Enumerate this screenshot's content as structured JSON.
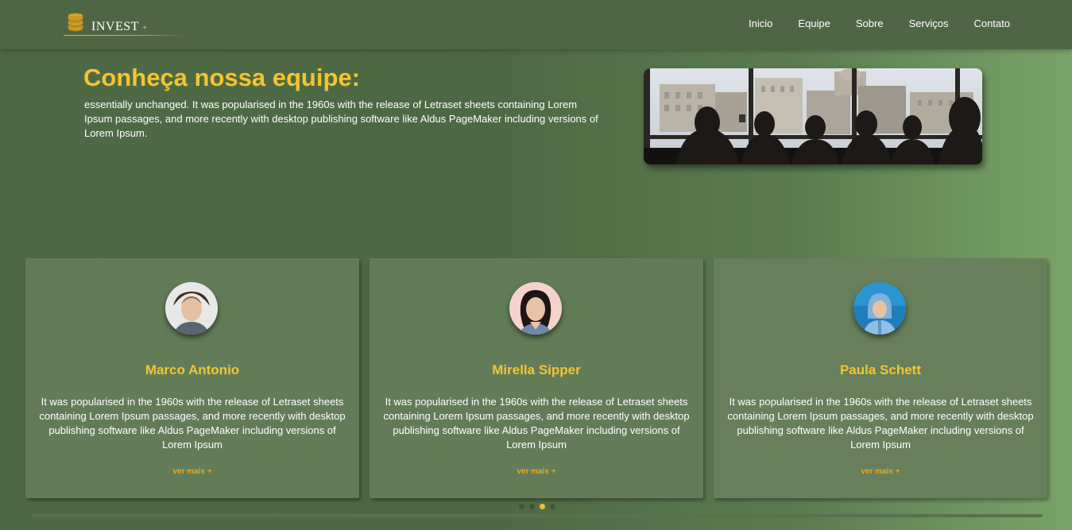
{
  "header": {
    "logo_text": "INVEST",
    "logo_plus": "+",
    "nav": [
      "Inicio",
      "Equipe",
      "Sobre",
      "Serviços",
      "Contato"
    ]
  },
  "hero": {
    "title": "Conheça nossa equipe:",
    "text": "essentially unchanged. It was popularised in the 1960s with the release of Letraset sheets containing Lorem Ipsum passages, and more recently with desktop publishing software like Aldus PageMaker including versions of Lorem Ipsum."
  },
  "team": [
    {
      "name": "Marco Antonio",
      "text": "It was popularised in the 1960s with the release of Letraset sheets containing Lorem Ipsum passages, and more recently with desktop publishing software like Aldus PageMaker including versions of Lorem Ipsum",
      "link": "ver mais +"
    },
    {
      "name": "Mirella Sipper",
      "text": "It was popularised in the 1960s with the release of Letraset sheets containing Lorem Ipsum passages, and more recently with desktop publishing software like Aldus PageMaker including versions of Lorem Ipsum",
      "link": "ver mais +"
    },
    {
      "name": "Paula Schett",
      "text": "It was popularised in the 1960s with the release of Letraset sheets containing Lorem Ipsum passages, and more recently with desktop publishing software like Aldus PageMaker including versions of Lorem Ipsum",
      "link": "ver mais +"
    }
  ],
  "pagination": {
    "count": 4,
    "active": 3
  },
  "colors": {
    "accent": "#f4c430",
    "link": "#e3a92a",
    "header_bg": "#4f6644",
    "card_bg": "#637c58"
  },
  "icons": {
    "logo": "coin-stack-icon"
  }
}
